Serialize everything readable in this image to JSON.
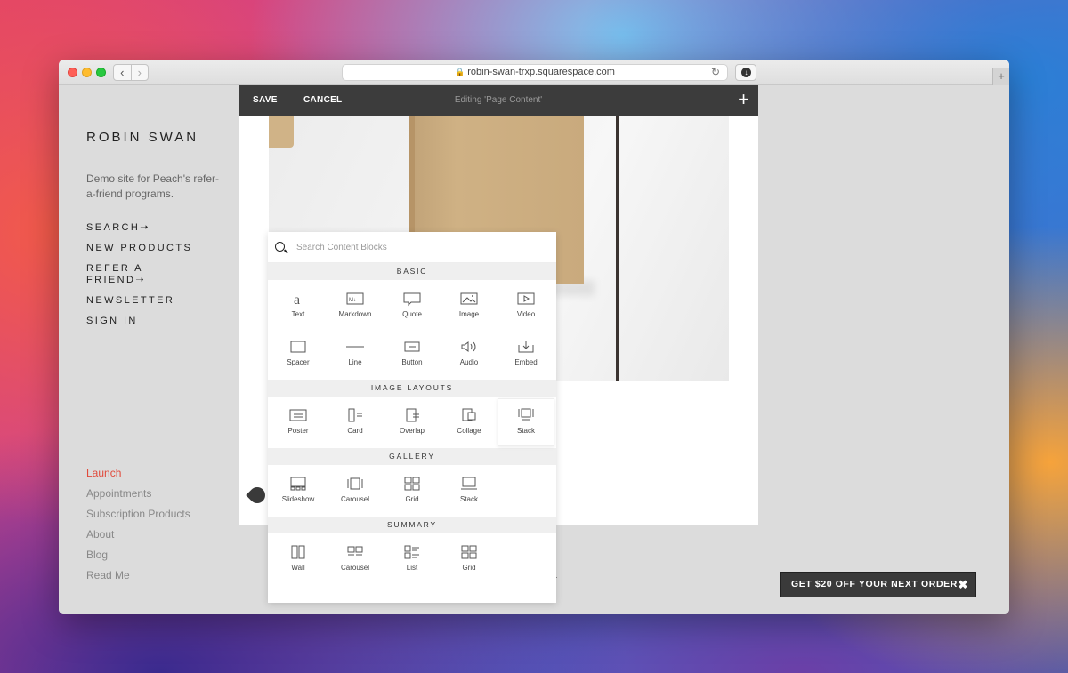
{
  "browser": {
    "url": "robin-swan-trxp.squarespace.com",
    "back": "‹",
    "forward": "›",
    "new_tab": "+"
  },
  "site": {
    "title": "ROBIN SWAN",
    "description": "Demo site for Peach's refer-a-friend programs.",
    "main_nav": [
      "SEARCH➝",
      "NEW PRODUCTS",
      "REFER A FRIEND➝",
      "NEWSLETTER",
      "SIGN IN"
    ],
    "sub_nav": [
      "Launch",
      "Appointments",
      "Subscription Products",
      "About",
      "Blog",
      "Read Me"
    ]
  },
  "editor": {
    "save_label": "SAVE",
    "cancel_label": "CANCEL",
    "title": "Editing 'Page Content'",
    "add_label": "+"
  },
  "picker": {
    "search_placeholder": "Search Content Blocks",
    "sections": [
      {
        "title": "BASIC",
        "items": [
          "Text",
          "Markdown",
          "Quote",
          "Image",
          "Video",
          "Spacer",
          "Line",
          "Button",
          "Audio",
          "Embed"
        ]
      },
      {
        "title": "IMAGE LAYOUTS",
        "items": [
          "Poster",
          "Card",
          "Overlap",
          "Collage",
          "Stack"
        ]
      },
      {
        "title": "GALLERY",
        "items": [
          "Slideshow",
          "Carousel",
          "Grid",
          "Stack"
        ]
      },
      {
        "title": "SUMMARY",
        "items": [
          "Wall",
          "Carousel",
          "List",
          "Grid"
        ]
      }
    ]
  },
  "promo": {
    "text": "GET $20 OFF YOUR NEXT ORDER",
    "close": "✖"
  }
}
